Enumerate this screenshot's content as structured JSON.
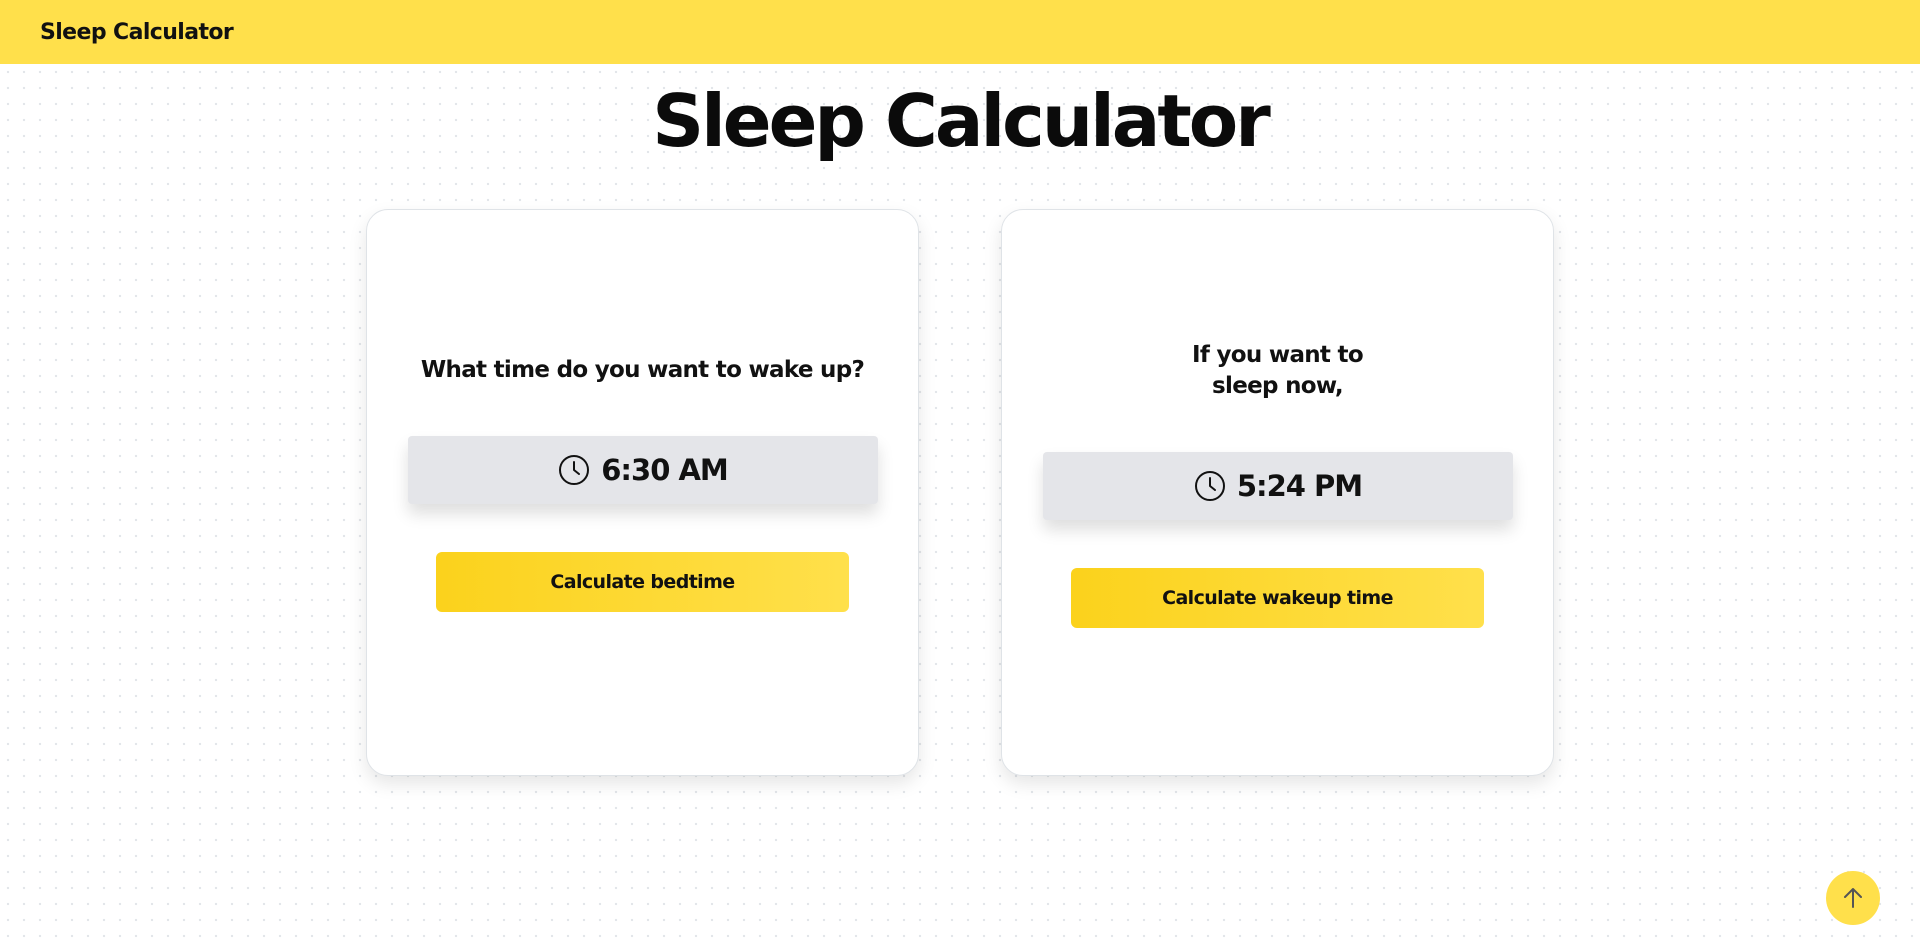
{
  "header": {
    "brand": "Sleep Calculator",
    "background_color": "#ffe04b"
  },
  "main": {
    "title": "Sleep Calculator"
  },
  "cards": {
    "bedtime": {
      "question": "What time do you want to wake up?",
      "time": "6:30 AM",
      "time_icon": "clock-icon",
      "button_label": "Calculate bedtime"
    },
    "wakeup": {
      "question": "If you want to sleep now,",
      "time": "5:24 PM",
      "time_icon": "clock-icon",
      "button_label": "Calculate wakeup time"
    }
  },
  "scroll_top": {
    "icon": "arrow-up-icon"
  },
  "colors": {
    "accent": "#ffe04b",
    "accent_dark": "#fbd21c",
    "time_box_bg": "#e4e5e9",
    "text": "#111111"
  }
}
